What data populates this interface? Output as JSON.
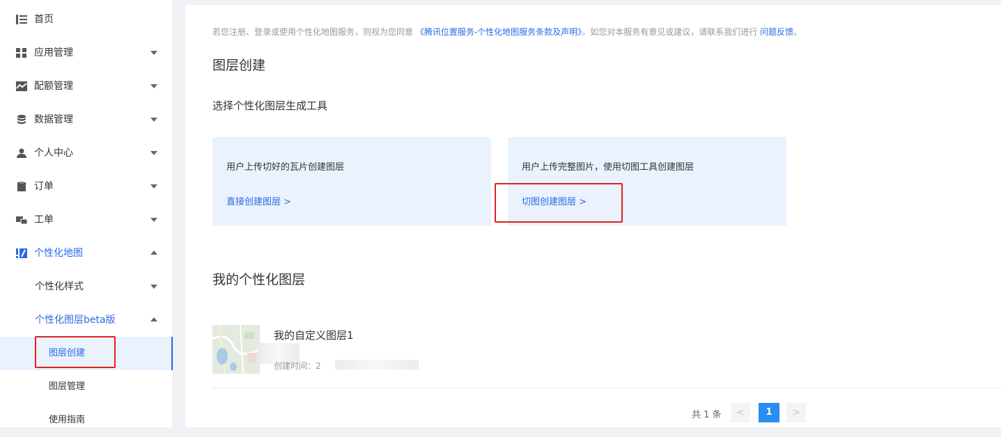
{
  "sidebar": {
    "items": [
      {
        "label": "首页",
        "icon": "home-list-icon"
      },
      {
        "label": "应用管理",
        "icon": "grid-icon"
      },
      {
        "label": "配额管理",
        "icon": "chart-icon"
      },
      {
        "label": "数据管理",
        "icon": "database-icon"
      },
      {
        "label": "个人中心",
        "icon": "user-icon"
      },
      {
        "label": "订单",
        "icon": "clipboard-icon"
      },
      {
        "label": "工单",
        "icon": "ticket-icon"
      },
      {
        "label": "个性化地图",
        "icon": "custom-map-icon"
      }
    ],
    "sub_items": [
      "个性化样式",
      "个性化图层beta版"
    ],
    "leaf_items": [
      "图层创建",
      "图层管理",
      "使用指南"
    ]
  },
  "notice": {
    "prefix": "若您注册、登录或使用个性化地图服务，则视为您同意",
    "terms_link": "《腾讯位置服务-个性化地图服务条款及声明》",
    "middle": "。如您对本服务有意见或建议，请联系我们进行",
    "feedback_link": "问题反馈",
    "suffix": "。"
  },
  "page_title": "图层创建",
  "section_subtitle": "选择个性化图层生成工具",
  "cards": [
    {
      "desc": "用户上传切好的瓦片创建图层",
      "link": "直接创建图层 >"
    },
    {
      "desc": "用户上传完整图片，使用切图工具创建图层",
      "link": "切图创建图层 >"
    }
  ],
  "my_layers_title": "我的个性化图层",
  "layers": [
    {
      "name": "我的自定义图层1",
      "created_label": "创建时间：2"
    }
  ],
  "pagination": {
    "total": "共 1 条",
    "prev": "<",
    "current": "1",
    "next": ">"
  },
  "colors": {
    "accent": "#2a6be4",
    "highlight_box": "#e02020",
    "card_bg": "#eaf2fd"
  }
}
